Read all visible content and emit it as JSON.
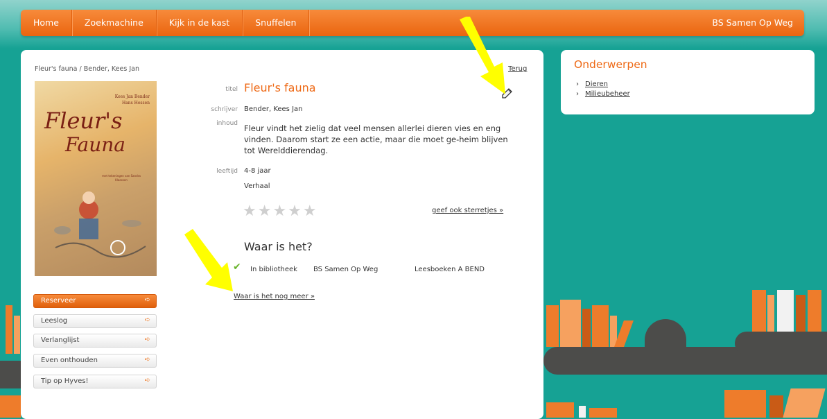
{
  "nav": {
    "items": [
      "Home",
      "Zoekmachine",
      "Kijk in de kast",
      "Snuffelen"
    ],
    "school": "BS Samen Op Weg"
  },
  "book": {
    "breadcrumb": "Fleur's fauna / Bender, Kees Jan",
    "back_label": "Terug",
    "cover": {
      "authors": "Kees Jan Bender\nHans Hessen",
      "title_line1": "Fleur's",
      "title_line2": "Fauna",
      "subtitle": "met tekeningen van Sandra Klaassen"
    },
    "fields": {
      "title_label": "titel",
      "title_value": "Fleur's fauna",
      "author_label": "schrijver",
      "author_value": "Bender, Kees Jan",
      "content_label": "inhoud",
      "content_value": "Fleur vindt het zielig dat veel mensen allerlei dieren vies en eng vinden. Daarom start ze een actie, maar die moet ge-heim blijven tot Werelddierendag.",
      "age_label": "leeftijd",
      "age_value": "4-8 jaar",
      "genre_value": "Verhaal"
    },
    "rating": {
      "stars_glyphs": "★★★★★",
      "value": 0,
      "max": 5,
      "rate_link": "geef ook sterretjes »"
    },
    "availability": {
      "heading": "Waar is het?",
      "status": "In bibliotheek",
      "location": "BS Samen Op Weg",
      "shelf": "Leesboeken A BEND",
      "more_link": "Waar is het nog meer »"
    }
  },
  "actions": [
    {
      "label": "Reserveer",
      "arrow": "➪"
    },
    {
      "label": "Leeslog",
      "arrow": "➪"
    },
    {
      "label": "Verlanglijst",
      "arrow": "➪"
    },
    {
      "label": "Even onthouden",
      "arrow": "➪"
    },
    {
      "label": "Tip op Hyves!",
      "arrow": "➪"
    }
  ],
  "subjects": {
    "heading": "Onderwerpen",
    "chevron": "›",
    "items": [
      "Dieren",
      "Milieubeheer"
    ]
  },
  "colors": {
    "accent": "#ee6a17",
    "background": "#16a294",
    "shelf": "#4c4c4a",
    "annotation": "#ffff00"
  }
}
